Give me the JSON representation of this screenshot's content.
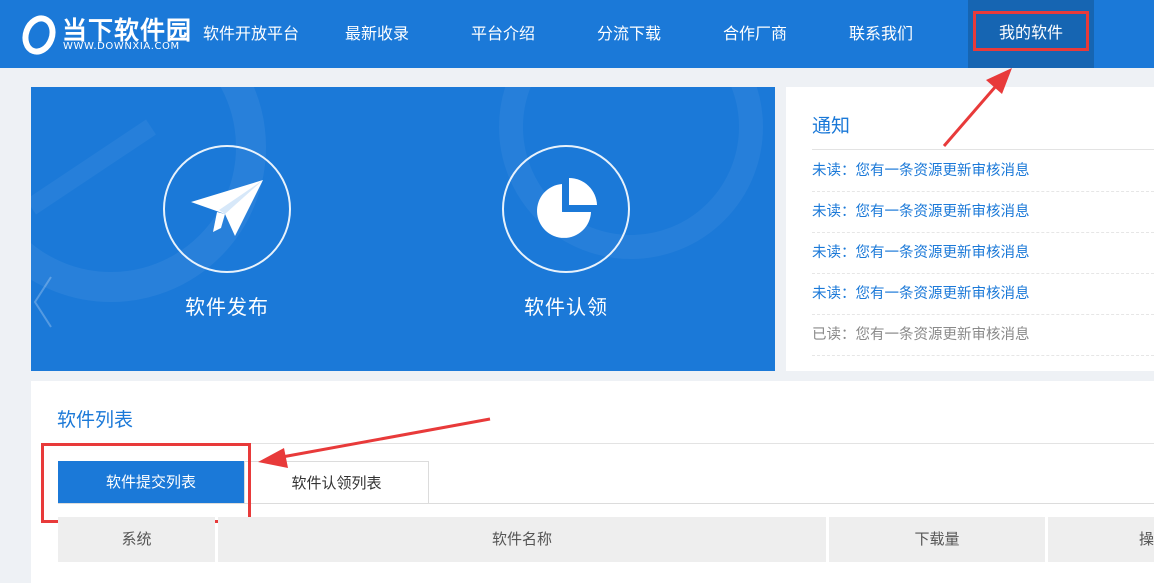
{
  "logo": {
    "title": "当下软件园",
    "url": "WWW.DOWNXIA.COM"
  },
  "nav": [
    {
      "label": "软件开放平台"
    },
    {
      "label": "最新收录"
    },
    {
      "label": "平台介绍"
    },
    {
      "label": "分流下载"
    },
    {
      "label": "合作厂商"
    },
    {
      "label": "联系我们"
    },
    {
      "label": "我的软件",
      "active": true
    }
  ],
  "banner": {
    "features": [
      {
        "label": "软件发布",
        "icon": "paper-plane-icon"
      },
      {
        "label": "软件认领",
        "icon": "pie-chart-icon"
      }
    ]
  },
  "notice": {
    "title": "通知",
    "items": [
      {
        "text": "未读：您有一条资源更新审核消息",
        "read": false
      },
      {
        "text": "未读：您有一条资源更新审核消息",
        "read": false
      },
      {
        "text": "未读：您有一条资源更新审核消息",
        "read": false
      },
      {
        "text": "未读：您有一条资源更新审核消息",
        "read": false
      },
      {
        "text": "已读：您有一条资源更新审核消息",
        "read": true
      }
    ]
  },
  "list": {
    "title": "软件列表",
    "tabs": [
      {
        "label": "软件提交列表",
        "active": true
      },
      {
        "label": "软件认领列表",
        "active": false
      }
    ],
    "columns": [
      "系统",
      "软件名称",
      "下载量",
      "操"
    ]
  },
  "colors": {
    "brand": "#1b79d8",
    "nav_active": "#1665b2",
    "annotation": "#e83a3a"
  }
}
